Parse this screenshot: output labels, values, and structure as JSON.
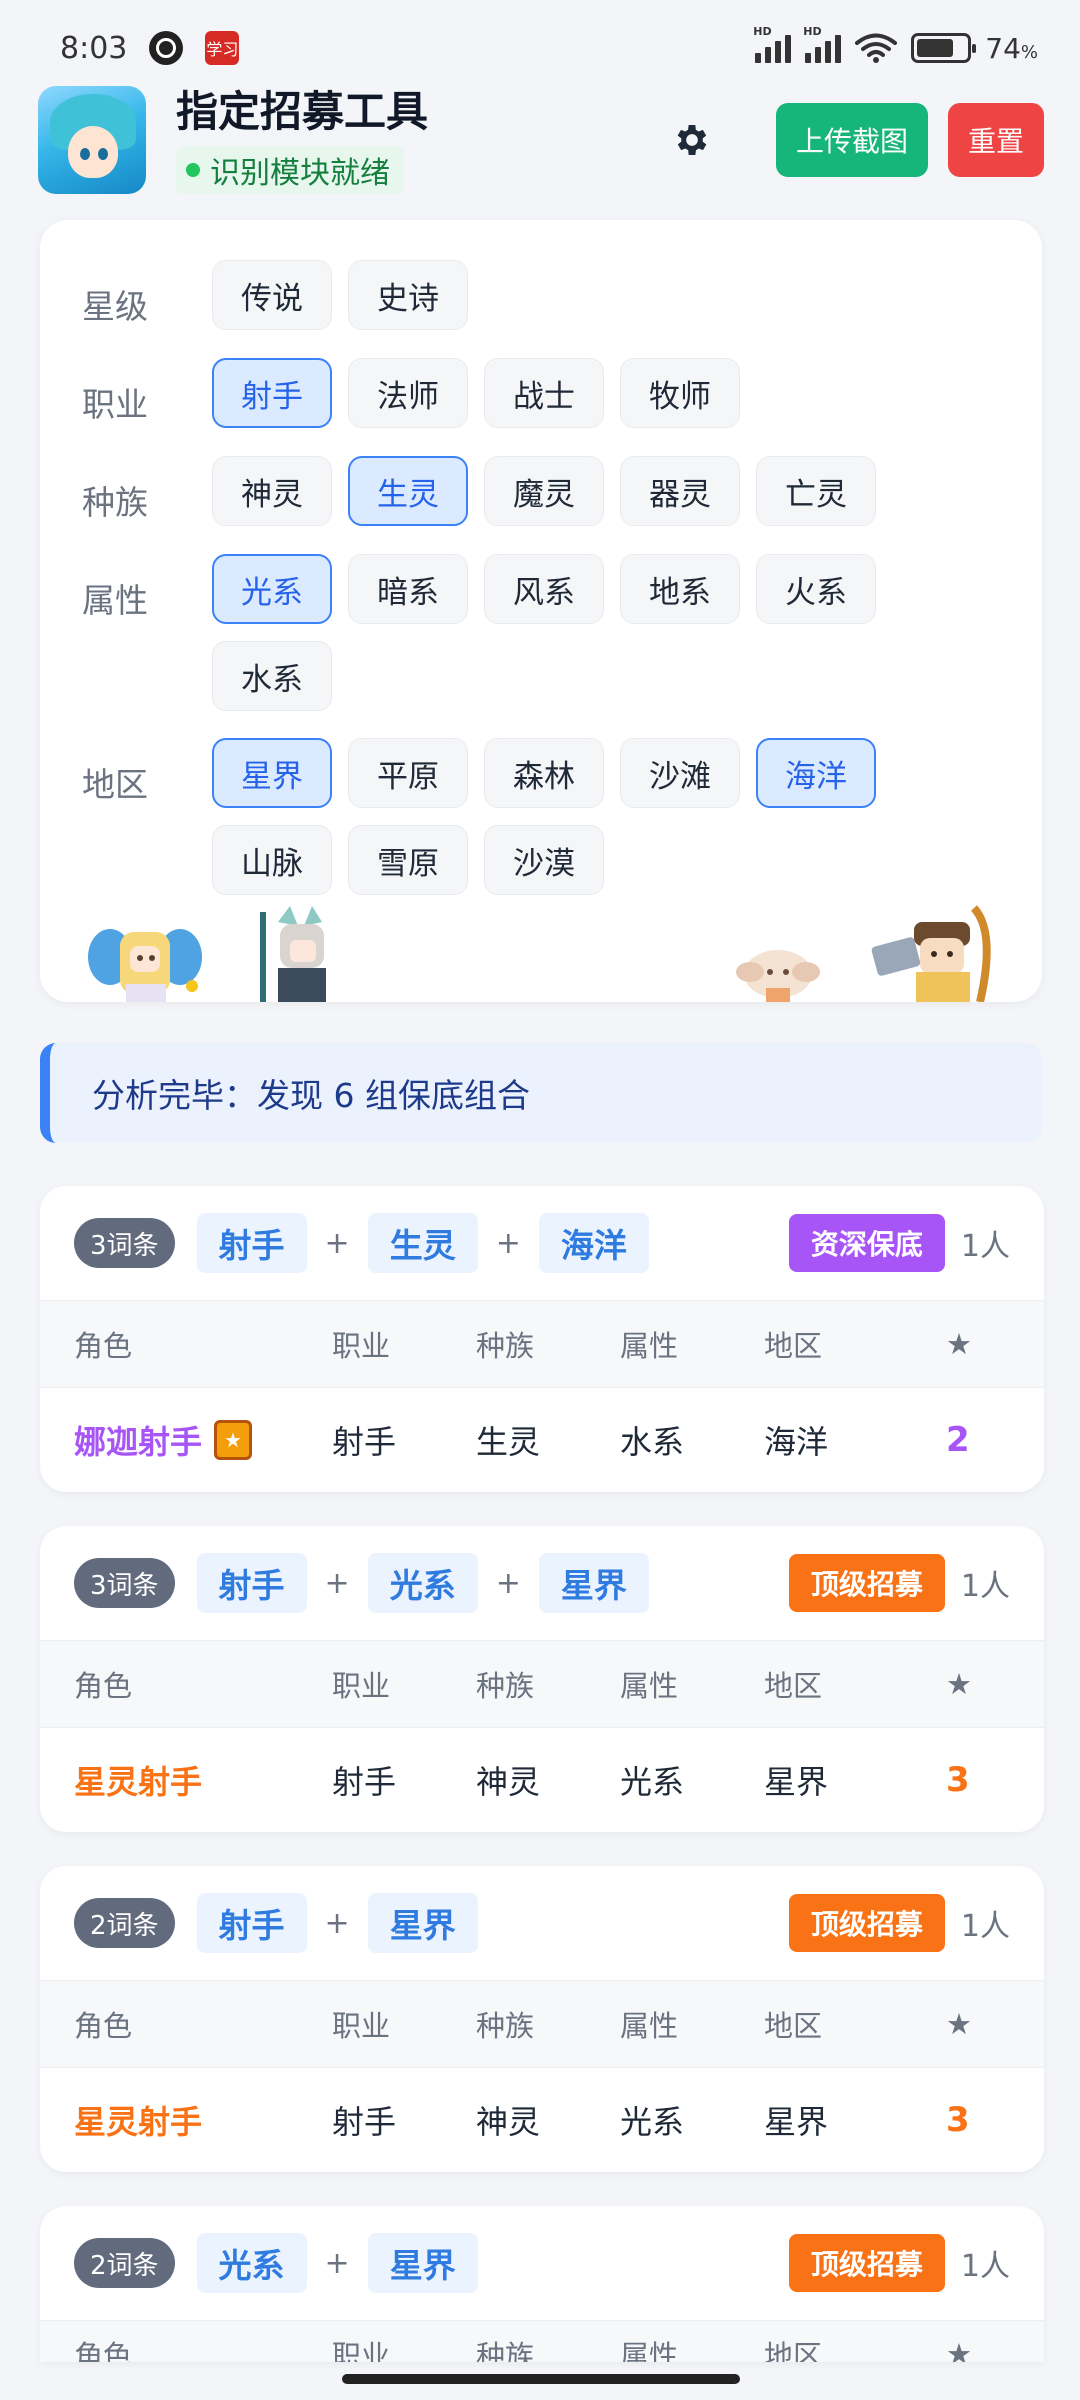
{
  "status_bar": {
    "time": "8:03",
    "app_icon_text": "学习",
    "battery": "74",
    "battery_unit": "%",
    "battery_level": 0.74,
    "signal_label": "HD"
  },
  "header": {
    "title": "指定招募工具",
    "status": "识别模块就绪",
    "upload_label": "上传截图",
    "reset_label": "重置",
    "gear_icon": "gear-icon"
  },
  "filters": {
    "star": {
      "label": "星级",
      "options": [
        "传说",
        "史诗"
      ]
    },
    "job": {
      "label": "职业",
      "options": [
        "射手",
        "法师",
        "战士",
        "牧师"
      ]
    },
    "race": {
      "label": "种族",
      "options": [
        "神灵",
        "生灵",
        "魔灵",
        "器灵",
        "亡灵"
      ]
    },
    "attr": {
      "label": "属性",
      "options": [
        "光系",
        "暗系",
        "风系",
        "地系",
        "火系",
        "水系"
      ]
    },
    "region": {
      "label": "地区",
      "options": [
        "星界",
        "平原",
        "森林",
        "沙滩",
        "海洋",
        "山脉",
        "雪原",
        "沙漠"
      ]
    }
  },
  "banner": {
    "text": "分析完毕：发现 6 组保底组合"
  },
  "table_header": {
    "hero": "角色",
    "job": "职业",
    "race": "种族",
    "attr": "属性",
    "region": "地区",
    "star": "★"
  },
  "results": [
    {
      "count": "3词条",
      "tags": [
        "射手",
        "生灵",
        "海洋"
      ],
      "tier": "资深保底",
      "people": "1人",
      "row": {
        "hero": "娜迦射手",
        "job": "射手",
        "race": "生灵",
        "attr": "水系",
        "region": "海洋",
        "star": "2"
      }
    },
    {
      "count": "3词条",
      "tags": [
        "射手",
        "光系",
        "星界"
      ],
      "tier": "顶级招募",
      "people": "1人",
      "row": {
        "hero": "星灵射手",
        "job": "射手",
        "race": "神灵",
        "attr": "光系",
        "region": "星界",
        "star": "3"
      }
    },
    {
      "count": "2词条",
      "tags": [
        "射手",
        "星界"
      ],
      "tier": "顶级招募",
      "people": "1人",
      "row": {
        "hero": "星灵射手",
        "job": "射手",
        "race": "神灵",
        "attr": "光系",
        "region": "星界",
        "star": "3"
      }
    },
    {
      "count": "2词条",
      "tags": [
        "光系",
        "星界"
      ],
      "tier": "顶级招募",
      "people": "1人"
    }
  ],
  "colors": {
    "accent_blue": "#3b82f6",
    "upload_green": "#16b57a",
    "reset_red": "#ef4444",
    "tier_purple": "#a855f7",
    "tier_orange": "#f97316"
  }
}
